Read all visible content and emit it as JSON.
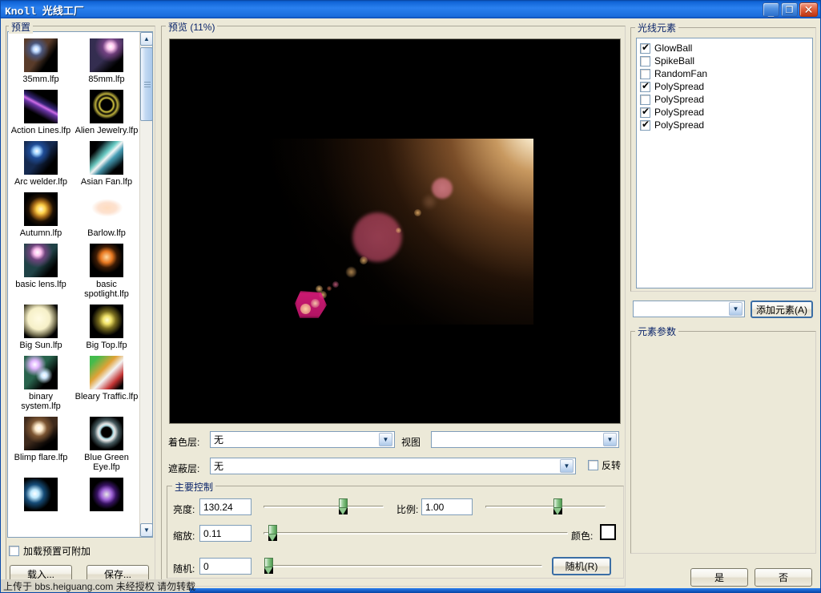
{
  "window": {
    "title": "Knoll 光线工厂",
    "minimize_label": "_",
    "restore_label": "❐",
    "close_label": "✕"
  },
  "presets_panel": {
    "group_label": "预置",
    "attach_checkbox_label": "加载预置可附加",
    "attach_checked": false,
    "load_button": "载入...",
    "save_button": "保存...",
    "items": [
      {
        "name": "35mm.lfp",
        "thumb": "lens-bluewhite"
      },
      {
        "name": "85mm.lfp",
        "thumb": "lens-pink"
      },
      {
        "name": "Action Lines.lfp",
        "thumb": "streak-purple"
      },
      {
        "name": "Alien Jewelry.lfp",
        "thumb": "ring-yellow"
      },
      {
        "name": "Arc welder.lfp",
        "thumb": "spark-blue"
      },
      {
        "name": "Asian Fan.lfp",
        "thumb": "fan-cyan"
      },
      {
        "name": "Autumn.lfp",
        "thumb": "star-gold"
      },
      {
        "name": "Barlow.lfp",
        "thumb": "soft-peach"
      },
      {
        "name": "basic lens.lfp",
        "thumb": "lens-magenta"
      },
      {
        "name": "basic spotlight.lfp",
        "thumb": "dot-orange"
      },
      {
        "name": "Big Sun.lfp",
        "thumb": "disc-cream"
      },
      {
        "name": "Big Top.lfp",
        "thumb": "star-yellow"
      },
      {
        "name": "binary system.lfp",
        "thumb": "binary-violet"
      },
      {
        "name": "Bleary Traffic.lfp",
        "thumb": "streak-orange"
      },
      {
        "name": "Blimp flare.lfp",
        "thumb": "flare-white"
      },
      {
        "name": "Blue Green Eye.lfp",
        "thumb": "eye-ring"
      },
      {
        "name": "",
        "thumb": "lens-cyan"
      },
      {
        "name": "",
        "thumb": "ring-purple"
      }
    ]
  },
  "preview": {
    "group_label": "预览 (11%)",
    "zoom_percent": 11
  },
  "layers": {
    "color_layer_label": "着色层:",
    "color_layer_value": "无",
    "view_label": "视图",
    "view_value": "",
    "mask_layer_label": "遮蔽层:",
    "mask_layer_value": "无",
    "invert_label": "反转",
    "invert_checked": false
  },
  "main_controls": {
    "group_label": "主要控制",
    "brightness_label": "亮度:",
    "brightness_value": "130.24",
    "brightness_pct": 66,
    "scale_label": "比例:",
    "scale_value": "1.00",
    "scale_pct": 60,
    "zoom_label": "缩放:",
    "zoom_value": "0.11",
    "zoom_pct": 3,
    "color_label": "颜色:",
    "color_value": "#ffffff",
    "random_label": "随机:",
    "random_value": "0",
    "random_pct": 1,
    "random_button": "随机(R)"
  },
  "elements_panel": {
    "group_label": "光线元素",
    "items": [
      {
        "name": "GlowBall",
        "checked": true
      },
      {
        "name": "SpikeBall",
        "checked": false
      },
      {
        "name": "RandomFan",
        "checked": false
      },
      {
        "name": "PolySpread",
        "checked": true
      },
      {
        "name": "PolySpread",
        "checked": false
      },
      {
        "name": "PolySpread",
        "checked": true
      },
      {
        "name": "PolySpread",
        "checked": true
      }
    ],
    "add_combo_value": "",
    "add_button": "添加元素(A)",
    "params_group_label": "元素参数"
  },
  "dialog_buttons": {
    "yes": "是",
    "no": "否"
  },
  "watermark": {
    "text": "上传于 bbs.heiguang.com 未经授权 请勿转载"
  },
  "colors": {
    "titlebar_blue": "#1266d8",
    "group_label_blue": "#0a246a",
    "face": "#ece9d8",
    "slider_green": "#8fc98f"
  }
}
